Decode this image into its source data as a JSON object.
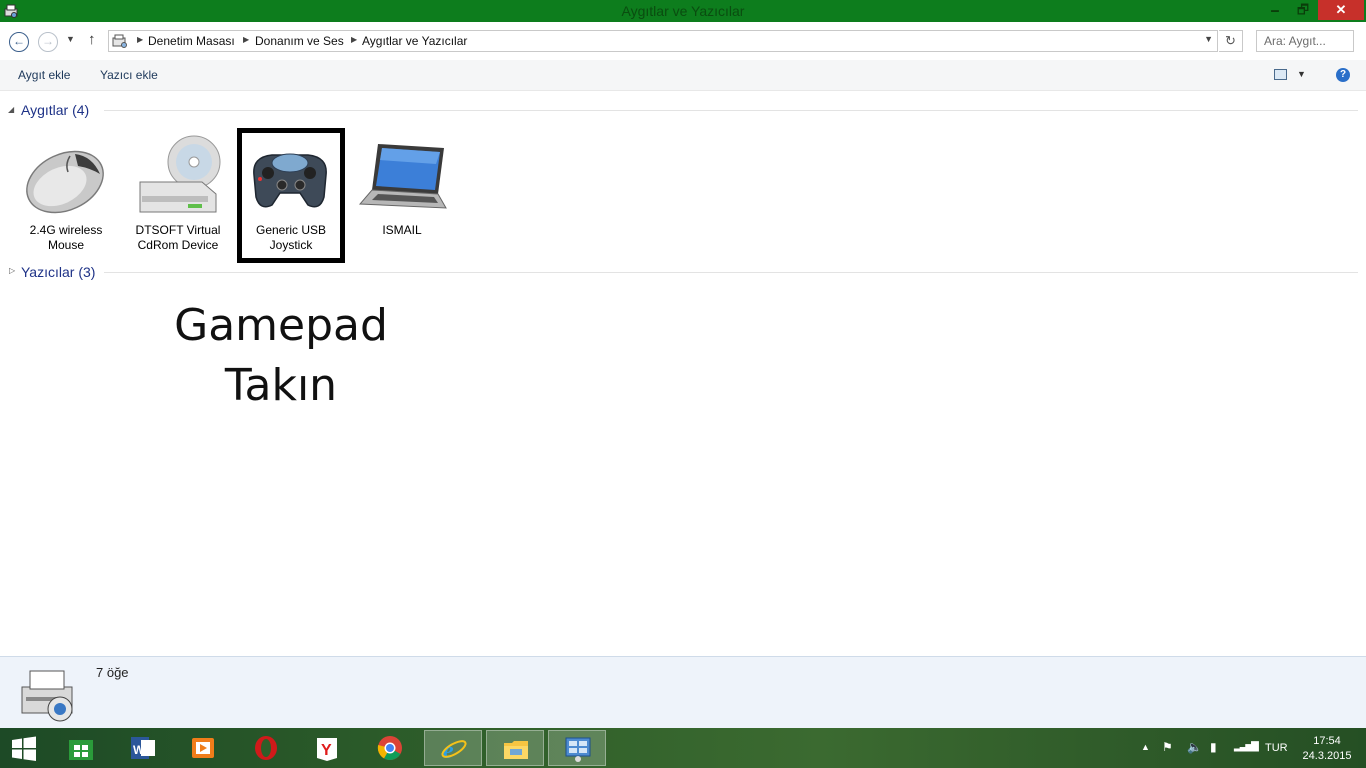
{
  "window": {
    "title": "Aygıtlar ve Yazıcılar",
    "minimize_glyph": "🗕",
    "maximize_glyph": "🗗",
    "close_glyph": "✕"
  },
  "address": {
    "crumbs": [
      "Denetim Masası",
      "Donanım ve Ses",
      "Aygıtlar ve Yazıcılar"
    ],
    "search_placeholder": "Ara: Aygıt..."
  },
  "toolbar": {
    "add_device": "Aygıt ekle",
    "add_printer": "Yazıcı ekle"
  },
  "groups": {
    "devices": {
      "label": "Aygıtlar (4)",
      "expanded": true
    },
    "printers": {
      "label": "Yazıcılar (3)",
      "expanded": false
    }
  },
  "devices": [
    {
      "name": "2.4G wireless\nMouse",
      "icon": "mouse-icon"
    },
    {
      "name": "DTSOFT Virtual\nCdRom Device",
      "icon": "cdrom-drive-icon"
    },
    {
      "name": "Generic   USB\nJoystick",
      "icon": "gamepad-icon",
      "selected": true
    },
    {
      "name": "ISMAIL",
      "icon": "laptop-icon"
    }
  ],
  "overlay": {
    "line1": "Gamepad",
    "line2": "Takın"
  },
  "details": {
    "item_count": "7 öğe"
  },
  "taskbar": {
    "apps": [
      "start-icon",
      "store-icon",
      "word-icon",
      "media-player-icon",
      "opera-icon",
      "yandex-icon",
      "chrome-icon",
      "internet-explorer-icon",
      "file-explorer-icon",
      "control-panel-icon"
    ],
    "language": "TUR",
    "time": "17:54",
    "date": "24.3.2015"
  },
  "colors": {
    "titlebar": "#0d7d1d",
    "close_button": "#c7302a",
    "group_header": "#1e3287",
    "details_pane": "#eef3fa"
  }
}
